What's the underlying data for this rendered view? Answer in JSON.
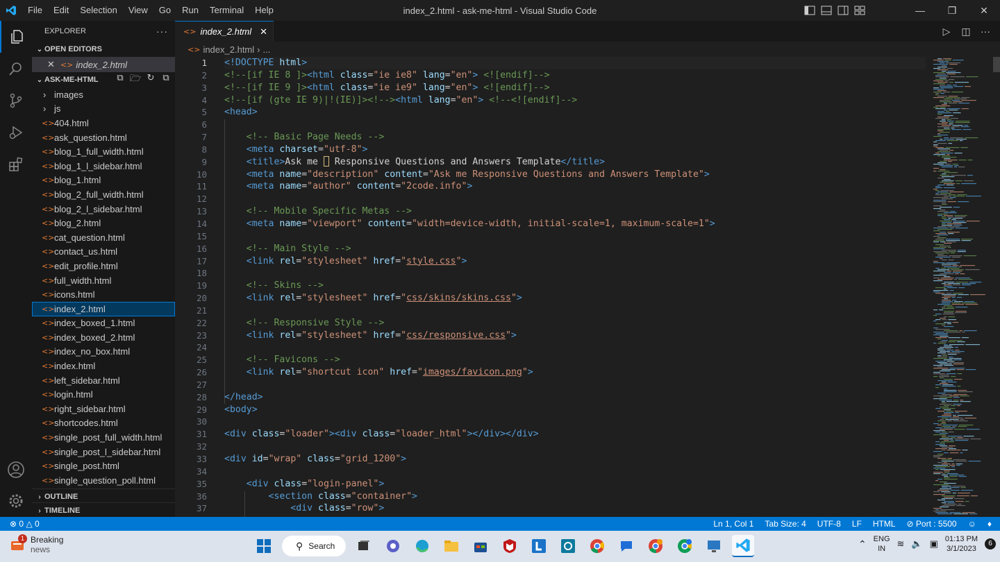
{
  "window": {
    "title": "index_2.html - ask-me-html - Visual Studio Code"
  },
  "menu": [
    "File",
    "Edit",
    "Selection",
    "View",
    "Go",
    "Run",
    "Terminal",
    "Help"
  ],
  "explorer": {
    "title": "EXPLORER",
    "open_editors_label": "OPEN EDITORS",
    "open_file": "index_2.html",
    "project_label": "ASK-ME-HTML",
    "folders": [
      "images",
      "js"
    ],
    "files": [
      "404.html",
      "ask_question.html",
      "blog_1_full_width.html",
      "blog_1_l_sidebar.html",
      "blog_1.html",
      "blog_2_full_width.html",
      "blog_2_l_sidebar.html",
      "blog_2.html",
      "cat_question.html",
      "contact_us.html",
      "edit_profile.html",
      "full_width.html",
      "icons.html",
      "index_2.html",
      "index_boxed_1.html",
      "index_boxed_2.html",
      "index_no_box.html",
      "index.html",
      "left_sidebar.html",
      "login.html",
      "right_sidebar.html",
      "shortcodes.html",
      "single_post_full_width.html",
      "single_post_l_sidebar.html",
      "single_post.html",
      "single_question_poll.html"
    ],
    "selected_file": "index_2.html",
    "outline_label": "OUTLINE",
    "timeline_label": "TIMELINE"
  },
  "tab": {
    "label": "index_2.html"
  },
  "breadcrumb": {
    "file": "index_2.html",
    "more": "..."
  },
  "editor": {
    "current_line": 1,
    "line_numbers": [
      "1",
      "2",
      "3",
      "4",
      "5",
      "6",
      "7",
      "8",
      "9",
      "10",
      "11",
      "12",
      "13",
      "14",
      "15",
      "16",
      "17",
      "18",
      "19",
      "20",
      "21",
      "22",
      "23",
      "24",
      "25",
      "26",
      "27",
      "28",
      "29",
      "30",
      "31",
      "32",
      "33",
      "34",
      "35",
      "36",
      "37"
    ]
  },
  "status": {
    "errors": "0",
    "warnings": "0",
    "position": "Ln 1, Col 1",
    "tab_size": "Tab Size: 4",
    "encoding": "UTF-8",
    "eol": "LF",
    "language": "HTML",
    "port": "Port : 5500"
  },
  "taskbar": {
    "news_title": "Breaking",
    "news_sub": "news",
    "news_badge": "1",
    "search_label": "Search",
    "lang_top": "ENG",
    "lang_bottom": "IN",
    "time": "01:13 PM",
    "date": "3/1/2023",
    "notif_count": "6"
  },
  "colors": {
    "accent": "#0078d4",
    "status_bar": "#0078d4",
    "file_icon": "#e37933"
  }
}
